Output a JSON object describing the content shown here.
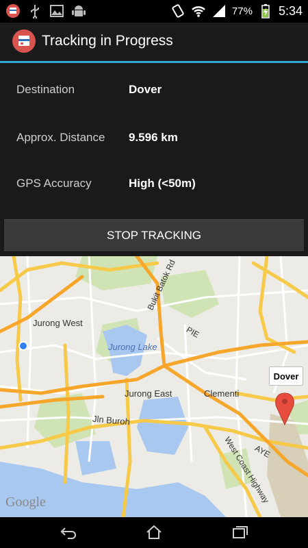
{
  "status_bar": {
    "battery_percent": "77%",
    "time": "5:34",
    "icons": [
      "app-notification-icon",
      "usb-icon",
      "image-icon",
      "android-debug-icon",
      "vibrate-icon",
      "wifi-icon",
      "signal-icon",
      "battery-charging-icon"
    ]
  },
  "action_bar": {
    "title": "Tracking in Progress",
    "accent": "#33a7d8"
  },
  "info": {
    "rows": [
      {
        "label": "Destination",
        "value": "Dover"
      },
      {
        "label": "Approx. Distance",
        "value": "9.596 km"
      },
      {
        "label": "GPS Accuracy",
        "value": "High (<50m)"
      }
    ]
  },
  "stop_button": {
    "label": "STOP TRACKING"
  },
  "map": {
    "labels": {
      "jurong_west": "Jurong West",
      "jurong_lake": "Jurong Lake",
      "jurong_east": "Jurong East",
      "clementi": "Clementi",
      "jln_buroh": "Jln Buroh",
      "bukit_batok_rd": "Bukit Batok Rd",
      "pie": "PIE",
      "aye": "AYE",
      "west_coast_hwy": "West Coast Highway"
    },
    "marker_callout": "Dover",
    "attribution": "Google"
  },
  "nav_bar": {
    "icons": [
      "back-icon",
      "home-icon",
      "recent-apps-icon"
    ]
  }
}
